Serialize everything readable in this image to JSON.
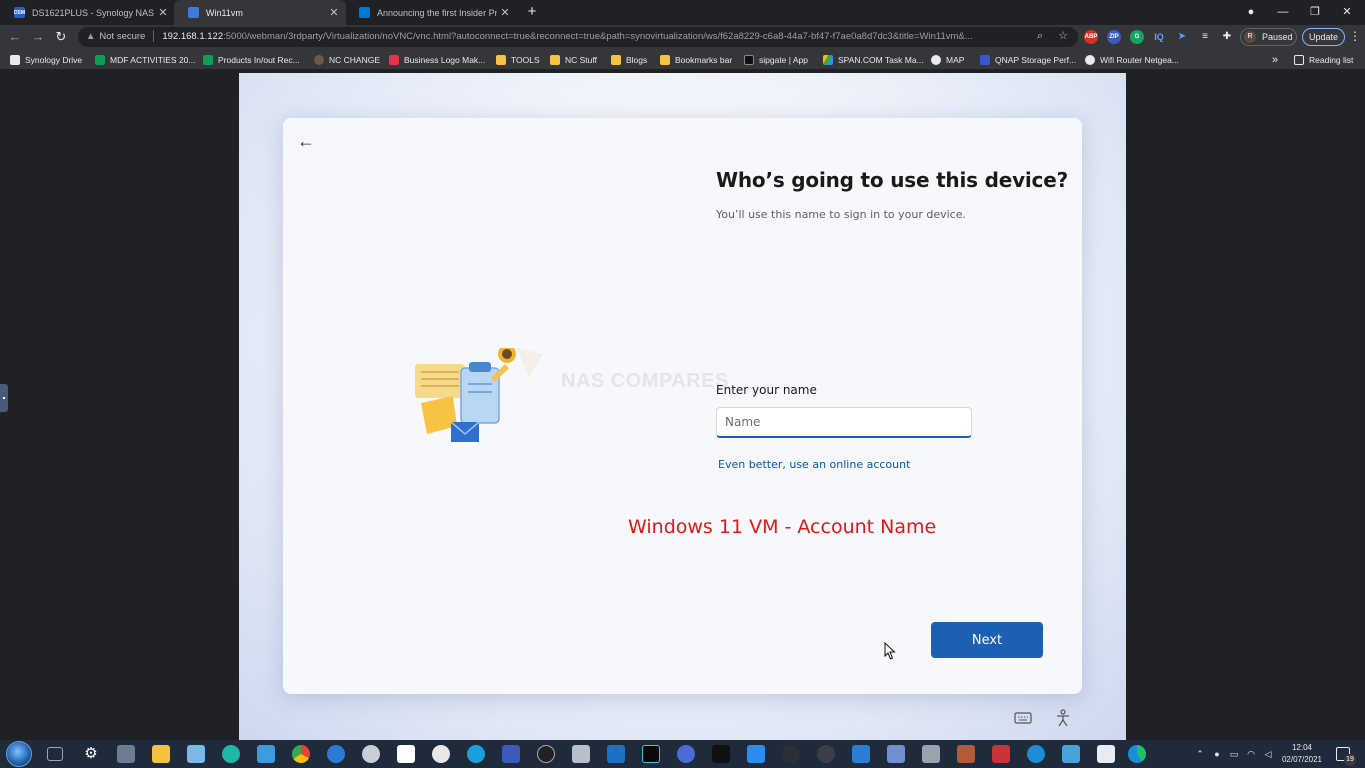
{
  "browser": {
    "tabs": [
      {
        "label": "DS1621PLUS - Synology NAS",
        "favicon": "dsm-icon",
        "favicon_text": "DSM",
        "active": false
      },
      {
        "label": "Win11vm",
        "favicon": "monitor-icon",
        "active": true
      },
      {
        "label": "Announcing the first Insider Prev",
        "favicon": "windows-icon",
        "active": false
      }
    ],
    "new_tab_glyph": "+",
    "omnibox": {
      "security_label": "Not secure",
      "host": "192.168.1.122",
      "path": ":5000/webman/3rdparty/Virtualization/noVNC/vnc.html?autoconnect=true&reconnect=true&path=synovirtualization/ws/f62a8229-c6a8-44a7-bf47-f7ae0a8d7dc3&title=Win11vm&..."
    },
    "profile": {
      "initial": "R",
      "label": "Paused"
    },
    "update_label": "Update",
    "bookmarks": [
      {
        "label": "Synology Drive",
        "icon": "synology-drive-icon"
      },
      {
        "label": "MDF ACTIVITIES 20...",
        "icon": "sheets-icon"
      },
      {
        "label": "Products In/out Rec...",
        "icon": "sheets-icon"
      },
      {
        "label": "NC CHANGE",
        "icon": "person-icon"
      },
      {
        "label": "Business Logo Mak...",
        "icon": "rocket-icon"
      },
      {
        "label": "TOOLS",
        "icon": "folder-icon"
      },
      {
        "label": "NC Stuff",
        "icon": "folder-icon"
      },
      {
        "label": "Blogs",
        "icon": "folder-icon"
      },
      {
        "label": "Bookmarks bar",
        "icon": "folder-icon"
      },
      {
        "label": "sipgate | App",
        "icon": "sipgate-icon"
      },
      {
        "label": "SPAN.COM Task Ma...",
        "icon": "drive-icon"
      },
      {
        "label": "MAP",
        "icon": "wordpress-icon"
      },
      {
        "label": "QNAP Storage Perf...",
        "icon": "qnap-icon"
      },
      {
        "label": "Wifi Router Netgea...",
        "icon": "globe-icon"
      }
    ],
    "more_bookmarks_glyph": "»",
    "reading_list_label": "Reading list"
  },
  "oobe": {
    "title": "Who’s going to use this device?",
    "subtitle": "You’ll use this name to sign in to your device.",
    "name_label": "Enter your name",
    "name_value": "",
    "name_placeholder": "Name",
    "online_account_link": "Even better, use an online account",
    "next_label": "Next",
    "watermark": "NAS COMPARES"
  },
  "overlay_caption": "Windows 11 VM - Account Name",
  "taskbar": {
    "time": "12:04",
    "date": "02/07/2021",
    "notification_count": "19"
  },
  "colors": {
    "accent": "#1c5fb3",
    "caption_red": "#e01818",
    "link": "#0b56a8"
  }
}
